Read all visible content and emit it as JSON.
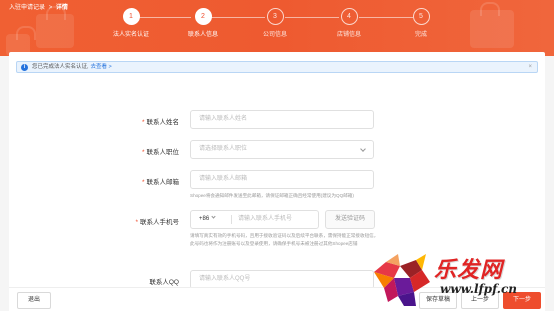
{
  "breadcrumb": {
    "parent": "入驻申请记录",
    "separator": ">",
    "current": "详情"
  },
  "steps": [
    {
      "num": "1",
      "label": "法人实名认证",
      "state": "done"
    },
    {
      "num": "2",
      "label": "联系人信息",
      "state": "active"
    },
    {
      "num": "3",
      "label": "公司信息",
      "state": "todo"
    },
    {
      "num": "4",
      "label": "店铺信息",
      "state": "todo"
    },
    {
      "num": "5",
      "label": "完成",
      "state": "todo"
    }
  ],
  "notice": {
    "text": "您已完成法人实名认证,",
    "link": "去查看 >",
    "close": "×"
  },
  "form": {
    "name": {
      "required": "*",
      "label": "联系人姓名",
      "placeholder": "请输入联系人姓名"
    },
    "position": {
      "required": "*",
      "label": "联系人职位",
      "placeholder": "请选择联系人职位"
    },
    "email": {
      "required": "*",
      "label": "联系人邮箱",
      "placeholder": "请输入联系人邮箱",
      "hint": "Shopee将会通知邮件发送至此邮箱，请保证邮箱正确且经常使用(建议为QQ邮箱)"
    },
    "phone": {
      "required": "*",
      "label": "联系人手机号",
      "prefix": "+86",
      "placeholder": "请输入联系人手机号",
      "code_button": "发送验证码",
      "hint": "请填写真实有效的手机号码，且用于接收验证码以及后续平台联系，需保持能正常接收短信，此号码也将作为注册账号以及登录使用，请确保手机号未被注册过其他Shopee店铺"
    },
    "qq": {
      "label": "联系人QQ",
      "placeholder": "请输入联系人QQ号"
    }
  },
  "footer": {
    "exit": "退出",
    "save_draft": "保存草稿",
    "prev": "上一步",
    "next": "下一步"
  },
  "watermark": {
    "brand": "乐发网",
    "url": "www.lfpf.cn"
  },
  "colors": {
    "brand": "#ee4d2d",
    "info": "#2673dd"
  }
}
